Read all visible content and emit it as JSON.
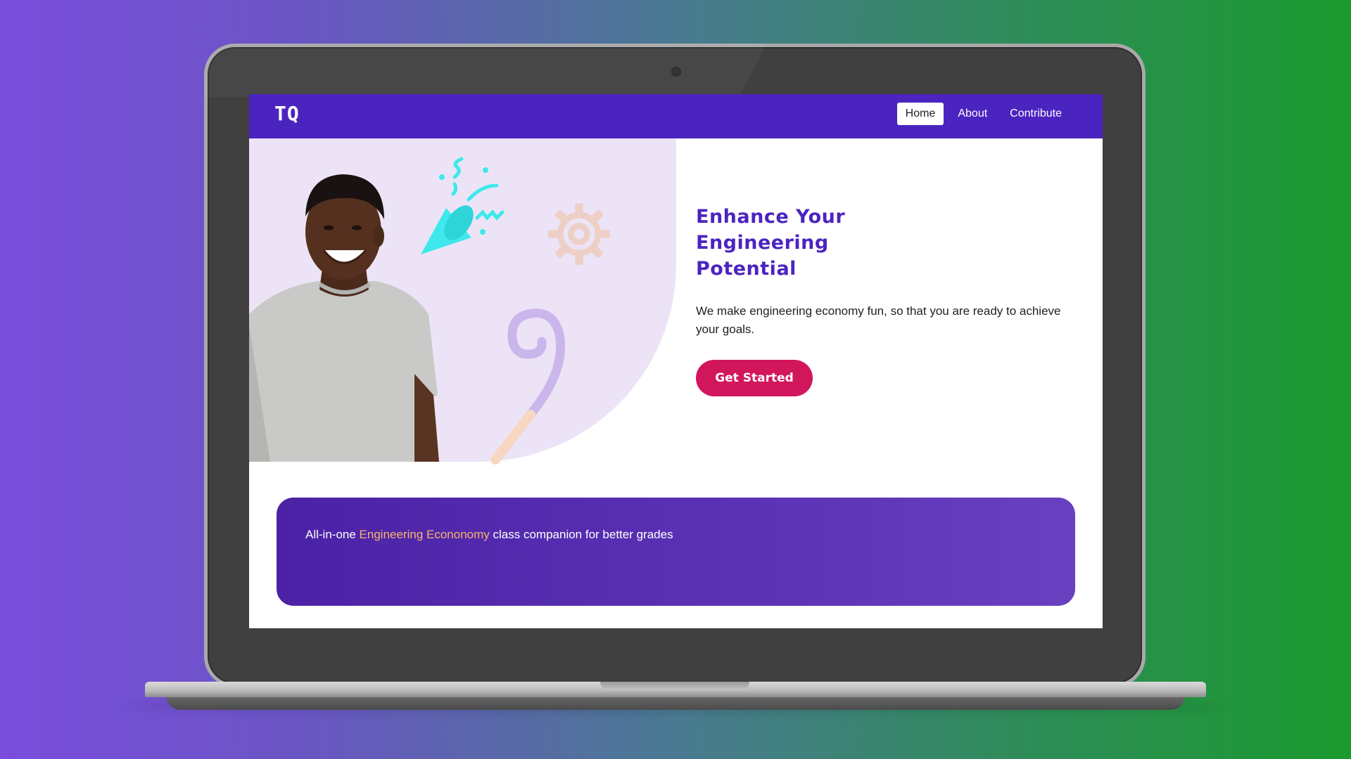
{
  "app": {
    "logo": "TQ"
  },
  "nav": {
    "items": [
      {
        "label": "Home",
        "active": true
      },
      {
        "label": "About",
        "active": false
      },
      {
        "label": "Contribute",
        "active": false
      }
    ]
  },
  "hero": {
    "title_lines": [
      "Enhance Your",
      "Engineering",
      "Potential"
    ],
    "description": "We make engineering economy fun, so that you are ready to achieve your goals.",
    "cta_label": "Get Started",
    "illustrations": [
      "party-popper-icon",
      "gear-icon",
      "party-horn-icon",
      "person-photo"
    ]
  },
  "banner": {
    "text_before": "All-in-one ",
    "highlight": "Engineering Econonomy",
    "text_after": " class companion for better grades"
  },
  "colors": {
    "brand": "#4b24c0",
    "cta": "#d2165c",
    "highlight": "#f6b46a",
    "hero_bg": "#ece4f6"
  }
}
